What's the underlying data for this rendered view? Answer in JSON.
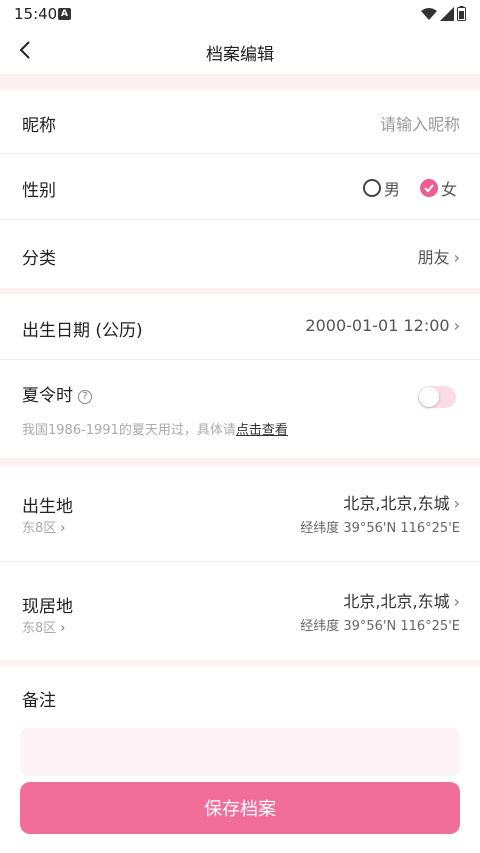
{
  "status": {
    "time": "15:40",
    "indicator": "A"
  },
  "nav": {
    "title": "档案编辑"
  },
  "nickname": {
    "label": "昵称",
    "placeholder": "请输入昵称"
  },
  "gender": {
    "label": "性别",
    "male": "男",
    "female": "女",
    "selected": "女"
  },
  "category": {
    "label": "分类",
    "value": "朋友"
  },
  "birth_date": {
    "label": "出生日期 (公历)",
    "value": "2000-01-01 12:00"
  },
  "dst": {
    "label": "夏令时",
    "hint_prefix": "我国1986-1991的夏天用过，具体请",
    "hint_link": "点击查看",
    "enabled": false
  },
  "birthplace": {
    "label": "出生地",
    "zone": "东8区",
    "place": "北京,北京,东城",
    "coords": "经纬度 39°56'N 116°25'E"
  },
  "residence": {
    "label": "现居地",
    "zone": "东8区",
    "place": "北京,北京,东城",
    "coords": "经纬度 39°56'N 116°25'E"
  },
  "remark": {
    "label": "备注"
  },
  "save_label": "保存档案",
  "colors": {
    "accent": "#f06e99",
    "section_bg": "#fdf1f4"
  }
}
